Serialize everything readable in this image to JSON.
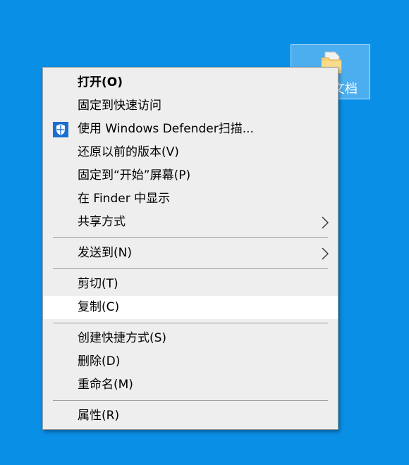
{
  "desktop": {
    "background_color": "#0a8fe6",
    "selected_item": {
      "label": "文档",
      "icon": "folder-icon"
    }
  },
  "context_menu": {
    "groups": [
      {
        "items": [
          {
            "label": "打开(O)",
            "bold": true
          },
          {
            "label": "固定到快速访问"
          },
          {
            "label": "使用 Windows Defender扫描...",
            "icon": "windows-defender-shield-icon"
          },
          {
            "label": "还原以前的版本(V)"
          },
          {
            "label": "固定到“开始”屏幕(P)"
          },
          {
            "label": "在 Finder 中显示"
          },
          {
            "label": "共享方式",
            "submenu": true
          }
        ]
      },
      {
        "items": [
          {
            "label": "发送到(N)",
            "submenu": true
          }
        ]
      },
      {
        "items": [
          {
            "label": "剪切(T)"
          },
          {
            "label": "复制(C)",
            "highlighted": true
          }
        ]
      },
      {
        "items": [
          {
            "label": "创建快捷方式(S)"
          },
          {
            "label": "删除(D)"
          },
          {
            "label": "重命名(M)"
          }
        ]
      },
      {
        "items": [
          {
            "label": "属性(R)"
          }
        ]
      }
    ]
  }
}
